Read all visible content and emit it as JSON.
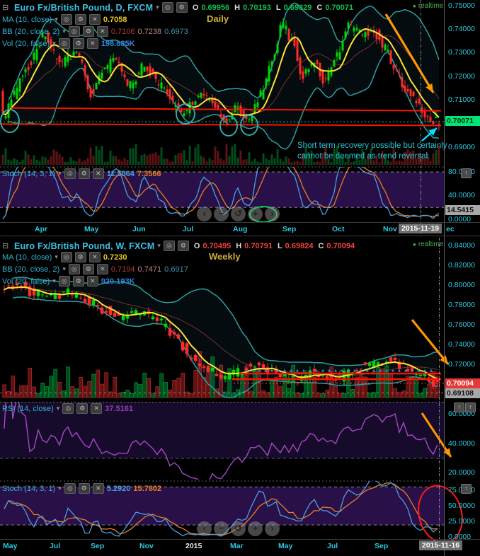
{
  "icons": {
    "window": "⊟",
    "caret": "▾",
    "eye": "◎",
    "gear": "⚙",
    "close": "✕",
    "dot": "●",
    "expand": "↑"
  },
  "ohlc_labels": {
    "o": "O",
    "h": "H",
    "l": "L",
    "c": "C"
  },
  "nav": {
    "buttons": [
      "‹",
      "−",
      "↺",
      "+",
      "›"
    ]
  },
  "daily": {
    "symbol": "Euro Fx/British Pound, D, FXCM",
    "ohlc": {
      "o": "0.69956",
      "h": "0.70193",
      "l": "0.69829",
      "c": "0.70071"
    },
    "watermark": "Daily",
    "realtime": "realtime",
    "indicators": [
      {
        "label": "MA (10, close)",
        "values": [
          "0.7058"
        ]
      },
      {
        "label": "BB (20, close, 2)",
        "values": [
          "0.7106",
          "0.7238",
          "0.6973"
        ]
      },
      {
        "label": "Vol (20, false)",
        "values": [
          "198.685K"
        ]
      }
    ],
    "annotation": {
      "line1": "Short term recovery possible but certainly",
      "line2": "cannot be deemed as trend reversal."
    },
    "axis": [
      "0.75000",
      "0.74000",
      "0.73000",
      "0.72000",
      "0.71000",
      "0.69000"
    ],
    "price_label": "0.70071",
    "stoch": {
      "label": "Stoch (14, 3, 1)",
      "k": "11.5564",
      "d": "7.3566",
      "axis": [
        "80.0000",
        "40.0000",
        "0.0000"
      ],
      "current": "14.5415"
    },
    "timeline": [
      "Apr",
      "May",
      "Jun",
      "Jul",
      "Aug",
      "Sep",
      "Oct",
      "Nov"
    ],
    "date_box": "2015-11-19",
    "after_box": "ec"
  },
  "weekly": {
    "symbol": "Euro Fx/British Pound, W, FXCM",
    "ohlc": {
      "o": "0.70495",
      "h": "0.70791",
      "l": "0.69824",
      "c": "0.70094"
    },
    "watermark": "Weekly",
    "realtime": "realtime",
    "indicators": [
      {
        "label": "MA (10, close)",
        "values": [
          "0.7230"
        ]
      },
      {
        "label": "BB (20, close, 2)",
        "values": [
          "0.7194",
          "0.7471",
          "0.6917"
        ]
      },
      {
        "label": "Vol (20, false)",
        "values": [
          "920.193K"
        ]
      }
    ],
    "axis": [
      "0.84000",
      "0.82000",
      "0.80000",
      "0.78000",
      "0.76000",
      "0.74000",
      "0.72000"
    ],
    "price_label": "0.70094",
    "low_label": "0.69108",
    "rsi": {
      "label": "RSI (14, close)",
      "value": "37.5161",
      "axis": [
        "60.0000",
        "40.0000",
        "20.0000"
      ]
    },
    "stoch": {
      "label": "Stoch (14, 3, 1)",
      "k": "5.2920",
      "d": "15.7802",
      "axis": [
        "75.0000",
        "50.0000",
        "25.0000",
        "0.0000"
      ]
    },
    "timeline": [
      "May",
      "Jul",
      "Sep",
      "Nov",
      "2015",
      "Mar",
      "May",
      "Jul",
      "Sep"
    ],
    "date_box": "2015-11-16"
  },
  "chart_data": [
    {
      "type": "candlestick",
      "title": "Euro Fx/British Pound, D, FXCM",
      "timeframe": "Daily",
      "ohlc_last": {
        "open": 0.69956,
        "high": 0.70193,
        "low": 0.69829,
        "close": 0.70071
      },
      "y_axis": {
        "min": 0.69,
        "max": 0.75,
        "ticks": [
          0.75,
          0.74,
          0.73,
          0.72,
          0.71,
          0.69
        ]
      },
      "x_axis": [
        "Apr",
        "May",
        "Jun",
        "Jul",
        "Aug",
        "Sep",
        "Oct",
        "Nov"
      ],
      "last_date": "2015-11-19",
      "indicators": {
        "ma10": 0.7058,
        "bb20": [
          0.7106,
          0.7238,
          0.6973
        ],
        "vol20": "198.685K",
        "stoch_14_3_1": {
          "k": 11.5564,
          "d": 7.3566,
          "current": 14.5415
        }
      },
      "level_lines": [
        0.7066,
        0.6998
      ],
      "current_price": 0.70071,
      "series_waypoints": [
        [
          0,
          0.716
        ],
        [
          8,
          0.702
        ],
        [
          20,
          0.712
        ],
        [
          40,
          0.724
        ],
        [
          65,
          0.737
        ],
        [
          85,
          0.726
        ],
        [
          110,
          0.73
        ],
        [
          130,
          0.713
        ],
        [
          150,
          0.722
        ],
        [
          165,
          0.728
        ],
        [
          185,
          0.716
        ],
        [
          205,
          0.724
        ],
        [
          230,
          0.716
        ],
        [
          260,
          0.7035
        ],
        [
          280,
          0.7115
        ],
        [
          300,
          0.71
        ],
        [
          320,
          0.7
        ],
        [
          335,
          0.708
        ],
        [
          350,
          0.7015
        ],
        [
          370,
          0.712
        ],
        [
          388,
          0.728
        ],
        [
          400,
          0.742
        ],
        [
          415,
          0.735
        ],
        [
          430,
          0.72
        ],
        [
          445,
          0.726
        ],
        [
          460,
          0.718
        ],
        [
          478,
          0.729
        ],
        [
          495,
          0.741
        ],
        [
          515,
          0.738
        ],
        [
          530,
          0.739
        ],
        [
          545,
          0.732
        ],
        [
          560,
          0.722
        ],
        [
          575,
          0.714
        ],
        [
          590,
          0.709
        ],
        [
          605,
          0.7035
        ],
        [
          618,
          0.7007
        ]
      ]
    },
    {
      "type": "candlestick",
      "title": "Euro Fx/British Pound, W, FXCM",
      "timeframe": "Weekly",
      "ohlc_last": {
        "open": 0.70495,
        "high": 0.70791,
        "low": 0.69824,
        "close": 0.70094
      },
      "y_axis": {
        "min": 0.688,
        "max": 0.84,
        "ticks": [
          0.84,
          0.82,
          0.8,
          0.78,
          0.76,
          0.74,
          0.72
        ]
      },
      "x_axis": [
        "May",
        "Jul",
        "Sep",
        "Nov",
        "2015",
        "Mar",
        "May",
        "Jul",
        "Sep"
      ],
      "last_date": "2015-11-16",
      "indicators": {
        "ma10": 0.723,
        "bb20": [
          0.7194,
          0.7471,
          0.6917
        ],
        "vol20": "920.193K",
        "rsi_14": 37.5161,
        "stoch_14_3_1": {
          "k": 5.292,
          "d": 15.7802
        }
      },
      "level_lines": [
        0.7107,
        0.705
      ],
      "low_marker": 0.69108,
      "current_price": 0.70094,
      "series_waypoints": [
        [
          0,
          0.796
        ],
        [
          25,
          0.801
        ],
        [
          50,
          0.792
        ],
        [
          75,
          0.788
        ],
        [
          100,
          0.792
        ],
        [
          125,
          0.784
        ],
        [
          150,
          0.775
        ],
        [
          170,
          0.768
        ],
        [
          190,
          0.772
        ],
        [
          210,
          0.77
        ],
        [
          230,
          0.762
        ],
        [
          250,
          0.748
        ],
        [
          270,
          0.73
        ],
        [
          285,
          0.722
        ],
        [
          300,
          0.713
        ],
        [
          320,
          0.708
        ],
        [
          340,
          0.712
        ],
        [
          360,
          0.72
        ],
        [
          380,
          0.714
        ],
        [
          400,
          0.708
        ],
        [
          420,
          0.705
        ],
        [
          440,
          0.711
        ],
        [
          460,
          0.707
        ],
        [
          480,
          0.706
        ],
        [
          500,
          0.714
        ],
        [
          520,
          0.719
        ],
        [
          540,
          0.722
        ],
        [
          555,
          0.726
        ],
        [
          570,
          0.718
        ],
        [
          585,
          0.712
        ],
        [
          600,
          0.707
        ],
        [
          615,
          0.701
        ]
      ]
    }
  ]
}
